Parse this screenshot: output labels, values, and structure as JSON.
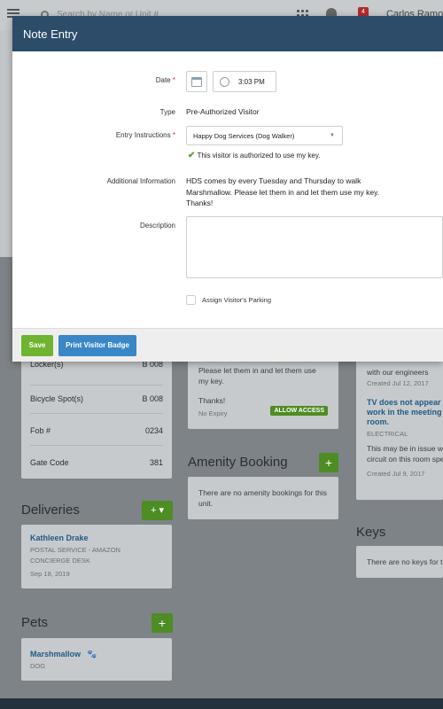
{
  "topbar": {
    "search_placeholder": "Search by Name or Unit #",
    "notification_count": "4",
    "user_name": "Carlos Ramos"
  },
  "background": {
    "info_card": {
      "rows": [
        {
          "label": "Locker(s)",
          "value": "B 008"
        },
        {
          "label": "Bicycle Spot(s)",
          "value": "B 008"
        },
        {
          "label": "Fob #",
          "value": "0234"
        },
        {
          "label": "Gate Code",
          "value": "381"
        }
      ]
    },
    "deliveries": {
      "title": "Deliveries",
      "item": {
        "name": "Kathleen Drake",
        "line1": "POSTAL SERVICE - AMAZON",
        "line2": "CONCIERGE DESK",
        "date": "Sep 18, 2019"
      }
    },
    "pets": {
      "title": "Pets",
      "item": {
        "name": "Marshmallow",
        "type": "DOG"
      }
    },
    "visitor_card": {
      "text_partial": "Please let them in and let them use my key.",
      "thanks": "Thanks!",
      "expiry": "No Expiry",
      "badge": "ALLOW ACCESS"
    },
    "amenity": {
      "title": "Amenity Booking",
      "empty": "There are no amenity bookings for this unit."
    },
    "issues": {
      "top_text": "with our engineers",
      "top_date": "Created Jul 12, 2017",
      "item_title": "TV does not appear to work in the meeting room.",
      "item_category": "ELECTRICAL",
      "item_body": "This may be in issue with the circuit on this room spec.",
      "item_date": "Created Jul 9, 2017"
    },
    "keys": {
      "title": "Keys",
      "empty": "There are no keys for this unit."
    }
  },
  "modal": {
    "title": "Note Entry",
    "date_label": "Date",
    "time_value": "3:03 PM",
    "type_label": "Type",
    "type_value": "Pre-Authorized Visitor",
    "entry_label": "Entry Instructions",
    "entry_value": "Happy Dog Services (Dog Walker)",
    "authorized_text": "This visitor is authorized to use my key.",
    "additional_label": "Additional Information",
    "additional_value": "HDS comes by every Tuesday and Thursday to walk Marshmallow. Please let them in and let them use my key. Thanks!",
    "description_label": "Description",
    "parking_label": "Assign Visitor's Parking",
    "save_label": "Save",
    "print_label": "Print Visitor Badge"
  },
  "colors": {
    "header": "#2c4c69",
    "save": "#6fb430",
    "print": "#3a87c8",
    "check": "#5aa52a",
    "required": "#d62c2c"
  }
}
